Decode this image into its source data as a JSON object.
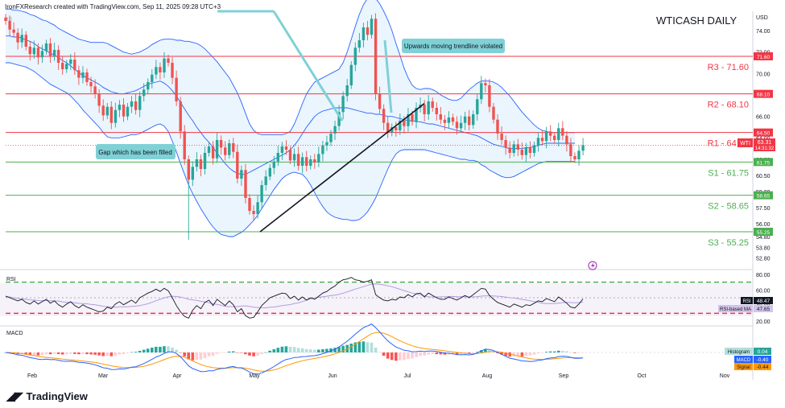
{
  "header": {
    "credit": "IronFXResearch created with TradingView.com, Sep 11, 2025 09:28 UTC+3",
    "indicator": "BB",
    "title": "WTICASH DAILY",
    "currency": "USD"
  },
  "footer": {
    "logo_text": "TradingView"
  },
  "colors": {
    "up": "#26a69a",
    "down": "#ef5350",
    "resistance": "#f23645",
    "support": "#4caf50",
    "bb": "#2962ff",
    "bb_fill": "#e3f2fd",
    "rsi": "#131722",
    "rsi_ma": "#b39ddb",
    "macd": "#2962ff",
    "signal": "#ff9800",
    "trend": "#131722",
    "callout": "#7fd1d6"
  },
  "chart_data": [
    {
      "type": "candlestick",
      "title": "WTICASH DAILY",
      "ylim": [
        51.8,
        75.8
      ],
      "yticks": [
        "74.00",
        "72.00",
        "70.00",
        "68.00",
        "66.00",
        "64.00",
        "62.00",
        "60.50",
        "59.00",
        "57.50",
        "56.00",
        "54.80",
        "53.80",
        "52.80"
      ],
      "xticks": [
        "Feb",
        "Mar",
        "Apr",
        "May",
        "Jun",
        "Jul",
        "Aug",
        "Sep",
        "Oct",
        "Nov"
      ],
      "levels": [
        {
          "label": "R3 - 71.60",
          "value": 71.6,
          "tag": "71.60",
          "kind": "resistance"
        },
        {
          "label": "R2 - 68.10",
          "value": 68.1,
          "tag": "68.10",
          "kind": "resistance"
        },
        {
          "label": "R1 - 64.50",
          "value": 64.5,
          "tag": "64.50",
          "kind": "resistance"
        },
        {
          "label": "S1 - 61.75",
          "value": 61.75,
          "tag": "61.75",
          "kind": "support"
        },
        {
          "label": "S2 - 58.65",
          "value": 58.65,
          "tag": "58.65",
          "kind": "support"
        },
        {
          "label": "S3 - 55.25",
          "value": 55.25,
          "tag": "55.25",
          "kind": "support"
        }
      ],
      "price_tag": {
        "symbol": "WTI",
        "value": "63.31",
        "countdown": "14:31:32"
      },
      "annotations": [
        "Gap which has been filled",
        "Upwards moving trendline violated"
      ],
      "closes": [
        74.9,
        74.1,
        73.8,
        72.9,
        73.6,
        72.5,
        71.8,
        72.4,
        71.5,
        72.1,
        72.8,
        71.6,
        72.2,
        71.0,
        70.4,
        70.9,
        71.3,
        70.3,
        69.6,
        70.1,
        69.2,
        68.8,
        68.1,
        67.0,
        66.1,
        66.9,
        65.4,
        66.6,
        67.1,
        66.0,
        66.9,
        67.4,
        66.6,
        67.9,
        68.5,
        69.2,
        69.9,
        70.6,
        70.1,
        71.4,
        71.0,
        69.6,
        67.4,
        64.6,
        62.0,
        60.1,
        61.3,
        62.0,
        61.1,
        62.6,
        63.2,
        62.1,
        63.8,
        63.1,
        62.4,
        63.5,
        62.7,
        60.2,
        61.0,
        58.4,
        57.2,
        56.9,
        58.0,
        59.6,
        60.4,
        61.2,
        61.8,
        62.6,
        63.2,
        62.9,
        61.9,
        62.5,
        61.4,
        62.2,
        61.4,
        62.0,
        61.7,
        62.5,
        63.3,
        63.6,
        64.4,
        65.1,
        66.4,
        67.9,
        68.9,
        70.8,
        72.4,
        73.1,
        74.3,
        73.6,
        75.1,
        68.1,
        66.7,
        65.4,
        64.5,
        65.0,
        64.7,
        65.6,
        65.1,
        66.2,
        65.5,
        66.8,
        67.1,
        66.2,
        67.4,
        66.8,
        66.2,
        65.7,
        65.4,
        65.9,
        65.5,
        64.9,
        65.4,
        66.0,
        65.2,
        66.2,
        67.6,
        69.1,
        68.9,
        66.9,
        65.7,
        64.4,
        63.8,
        63.1,
        62.6,
        63.4,
        62.9,
        62.4,
        63.1,
        62.6,
        63.3,
        64.0,
        63.7,
        64.6,
        64.2,
        63.8,
        64.9,
        64.2,
        63.4,
        62.3,
        62.0,
        62.8,
        63.31
      ],
      "bollinger": {
        "upper": [
          76.0,
          76.0,
          75.9,
          75.9,
          75.8,
          75.7,
          75.5,
          75.4,
          75.2,
          75.0,
          74.9,
          74.7,
          74.5,
          74.2,
          74.0,
          73.8,
          73.6,
          73.4,
          73.2,
          73.1,
          73.0,
          72.9,
          72.9,
          72.9,
          72.9,
          72.8,
          72.6,
          72.4,
          72.2,
          72.0,
          71.9,
          71.8,
          71.9,
          72.0,
          72.2,
          72.4,
          72.7,
          72.9,
          73.1,
          73.2,
          73.2,
          73.2,
          73.1,
          73.1,
          73.0,
          73.0,
          72.9,
          72.8,
          72.6,
          72.3,
          71.9,
          71.5,
          71.1,
          70.6,
          70.1,
          69.6,
          68.9,
          68.2,
          67.3,
          66.3,
          65.3,
          64.7,
          64.4,
          64.3,
          64.3,
          64.3,
          64.3,
          64.3,
          64.3,
          64.4,
          64.6,
          65.3,
          66.2,
          67.2,
          68.1,
          68.7,
          69.2,
          69.4,
          69.6,
          69.8,
          70.0,
          70.2,
          70.4,
          71.0,
          72.0,
          73.2,
          74.4,
          75.5,
          76.4,
          77.0,
          77.2,
          77.0,
          76.5,
          75.8,
          75.0,
          74.0,
          72.8,
          71.7,
          70.5,
          69.6,
          68.9,
          68.6,
          68.5,
          68.6,
          68.6,
          68.5,
          68.3,
          68.0,
          67.8,
          67.6,
          67.5,
          67.5,
          67.7,
          68.1,
          68.5,
          68.8,
          69.1,
          69.3,
          69.3,
          69.3,
          69.2,
          69.0,
          68.7,
          68.3,
          67.9,
          67.4,
          66.9,
          66.4,
          66.0,
          65.6,
          65.2,
          64.9,
          64.7,
          64.6,
          64.5,
          64.5,
          64.5,
          64.5,
          64.5,
          64.5,
          64.5
        ],
        "basis": [
          73.5,
          73.5,
          73.4,
          73.4,
          73.3,
          73.1,
          73.0,
          72.8,
          72.5,
          72.3,
          72.1,
          71.9,
          71.7,
          71.5,
          71.2,
          71.0,
          70.7,
          70.4,
          70.1,
          69.8,
          69.6,
          69.4,
          69.2,
          69.0,
          68.7,
          68.5,
          68.3,
          68.2,
          68.1,
          68.1,
          68.2,
          68.3,
          68.4,
          68.6,
          68.8,
          69.0,
          69.1,
          69.2,
          69.3,
          69.1,
          68.8,
          68.4,
          67.9,
          67.3,
          66.7,
          66.1,
          65.6,
          65.0,
          64.5,
          64.0,
          63.6,
          63.1,
          62.6,
          62.1,
          61.6,
          61.2,
          60.9,
          60.7,
          60.6,
          60.6,
          60.8,
          61.0,
          61.2,
          61.4,
          61.6,
          61.8,
          62.0,
          62.2,
          62.4,
          62.6,
          62.9,
          63.3,
          63.8,
          64.4,
          65.0,
          65.5,
          66.0,
          66.3,
          66.5,
          66.6,
          66.7,
          66.8,
          66.8,
          66.8,
          66.8,
          66.7,
          66.6,
          66.5,
          66.4,
          66.3,
          66.3,
          66.2,
          66.2,
          66.1,
          66.0,
          66.0,
          65.9,
          65.8,
          65.7,
          65.6,
          65.6,
          65.5,
          65.5,
          65.4,
          65.3,
          65.3,
          65.2,
          65.1,
          65.0,
          64.9,
          64.8,
          64.7,
          64.6,
          64.5,
          64.4,
          64.3,
          64.2,
          64.0,
          63.8,
          63.6,
          63.4,
          63.3,
          63.2,
          63.1,
          63.0,
          63.0,
          63.0,
          63.0,
          63.1,
          63.1,
          63.2,
          63.3,
          63.4,
          63.5,
          63.5,
          63.5,
          63.5,
          63.5,
          63.5,
          63.5,
          63.5
        ],
        "lower": [
          71.0,
          71.0,
          70.9,
          70.8,
          70.7,
          70.6,
          70.4,
          70.2,
          69.9,
          69.6,
          69.3,
          69.0,
          68.8,
          68.6,
          68.4,
          68.2,
          67.9,
          67.5,
          67.1,
          66.6,
          66.2,
          65.8,
          65.4,
          65.0,
          64.5,
          64.1,
          64.0,
          64.0,
          64.0,
          64.1,
          64.2,
          64.3,
          64.3,
          64.4,
          64.6,
          64.8,
          65.0,
          65.2,
          65.3,
          65.1,
          64.6,
          63.7,
          62.7,
          61.6,
          60.6,
          59.6,
          58.8,
          58.1,
          57.4,
          56.8,
          56.2,
          55.7,
          55.3,
          55.0,
          54.9,
          54.8,
          54.8,
          55.0,
          55.2,
          55.5,
          55.9,
          56.3,
          56.8,
          57.4,
          58.0,
          58.6,
          59.2,
          59.7,
          60.2,
          60.5,
          60.7,
          60.8,
          60.7,
          60.6,
          60.2,
          59.6,
          58.9,
          58.2,
          57.6,
          57.1,
          56.8,
          56.6,
          56.5,
          56.4,
          56.4,
          56.3,
          56.3,
          56.4,
          56.7,
          57.1,
          57.7,
          58.4,
          59.3,
          60.2,
          61.1,
          61.9,
          62.5,
          62.8,
          62.9,
          62.9,
          62.9,
          62.9,
          62.9,
          62.9,
          62.8,
          62.7,
          62.6,
          62.5,
          62.4,
          62.3,
          62.2,
          62.1,
          62.0,
          62.0,
          61.9,
          61.9,
          61.8,
          61.5,
          61.3,
          61.0,
          60.8,
          60.6,
          60.4,
          60.3,
          60.3,
          60.4,
          60.6,
          60.8,
          61.0,
          61.2,
          61.4,
          61.6,
          61.7,
          61.8,
          61.8,
          61.8,
          61.8,
          61.8,
          61.8,
          61.8,
          61.8
        ]
      }
    },
    {
      "type": "line",
      "title": "RSI",
      "ylim": [
        15,
        85
      ],
      "yticks": [
        "80.00",
        "60.00",
        "40.00",
        "20.00"
      ],
      "guides": [
        70,
        50,
        30
      ],
      "series": [
        {
          "name": "RSI",
          "value_label": "48.47",
          "values": [
            52,
            50,
            48,
            46,
            48,
            44,
            42,
            46,
            42,
            45,
            48,
            43,
            46,
            41,
            38,
            42,
            45,
            40,
            37,
            41,
            38,
            36,
            34,
            32,
            33,
            38,
            36,
            42,
            45,
            41,
            44,
            47,
            43,
            50,
            53,
            56,
            58,
            61,
            58,
            62,
            59,
            50,
            40,
            32,
            26,
            24,
            34,
            40,
            36,
            44,
            47,
            40,
            48,
            44,
            40,
            46,
            41,
            32,
            36,
            27,
            24,
            25,
            32,
            40,
            45,
            50,
            52,
            54,
            56,
            55,
            49,
            52,
            47,
            51,
            47,
            50,
            48,
            52,
            56,
            58,
            62,
            65,
            70,
            73,
            74,
            76,
            73,
            72,
            70,
            71,
            73,
            54,
            50,
            47,
            46,
            48,
            47,
            51,
            50,
            54,
            51,
            55,
            56,
            51,
            56,
            53,
            50,
            48,
            48,
            51,
            49,
            47,
            50,
            53,
            50,
            54,
            58,
            62,
            61,
            53,
            48,
            44,
            42,
            40,
            38,
            42,
            40,
            38,
            41,
            40,
            43,
            46,
            45,
            49,
            47,
            45,
            51,
            47,
            43,
            38,
            37,
            42,
            48.47
          ]
        },
        {
          "name": "RSI-based MA",
          "value_label": "47.65"
        }
      ]
    },
    {
      "type": "bar",
      "title": "MACD",
      "ylim": [
        -2.8,
        2.8
      ],
      "series": [
        {
          "name": "Histogram",
          "value_label": "0.04"
        },
        {
          "name": "MACD",
          "value_label": "-0.40"
        },
        {
          "name": "Signal",
          "value_label": "-0.44"
        }
      ]
    }
  ]
}
